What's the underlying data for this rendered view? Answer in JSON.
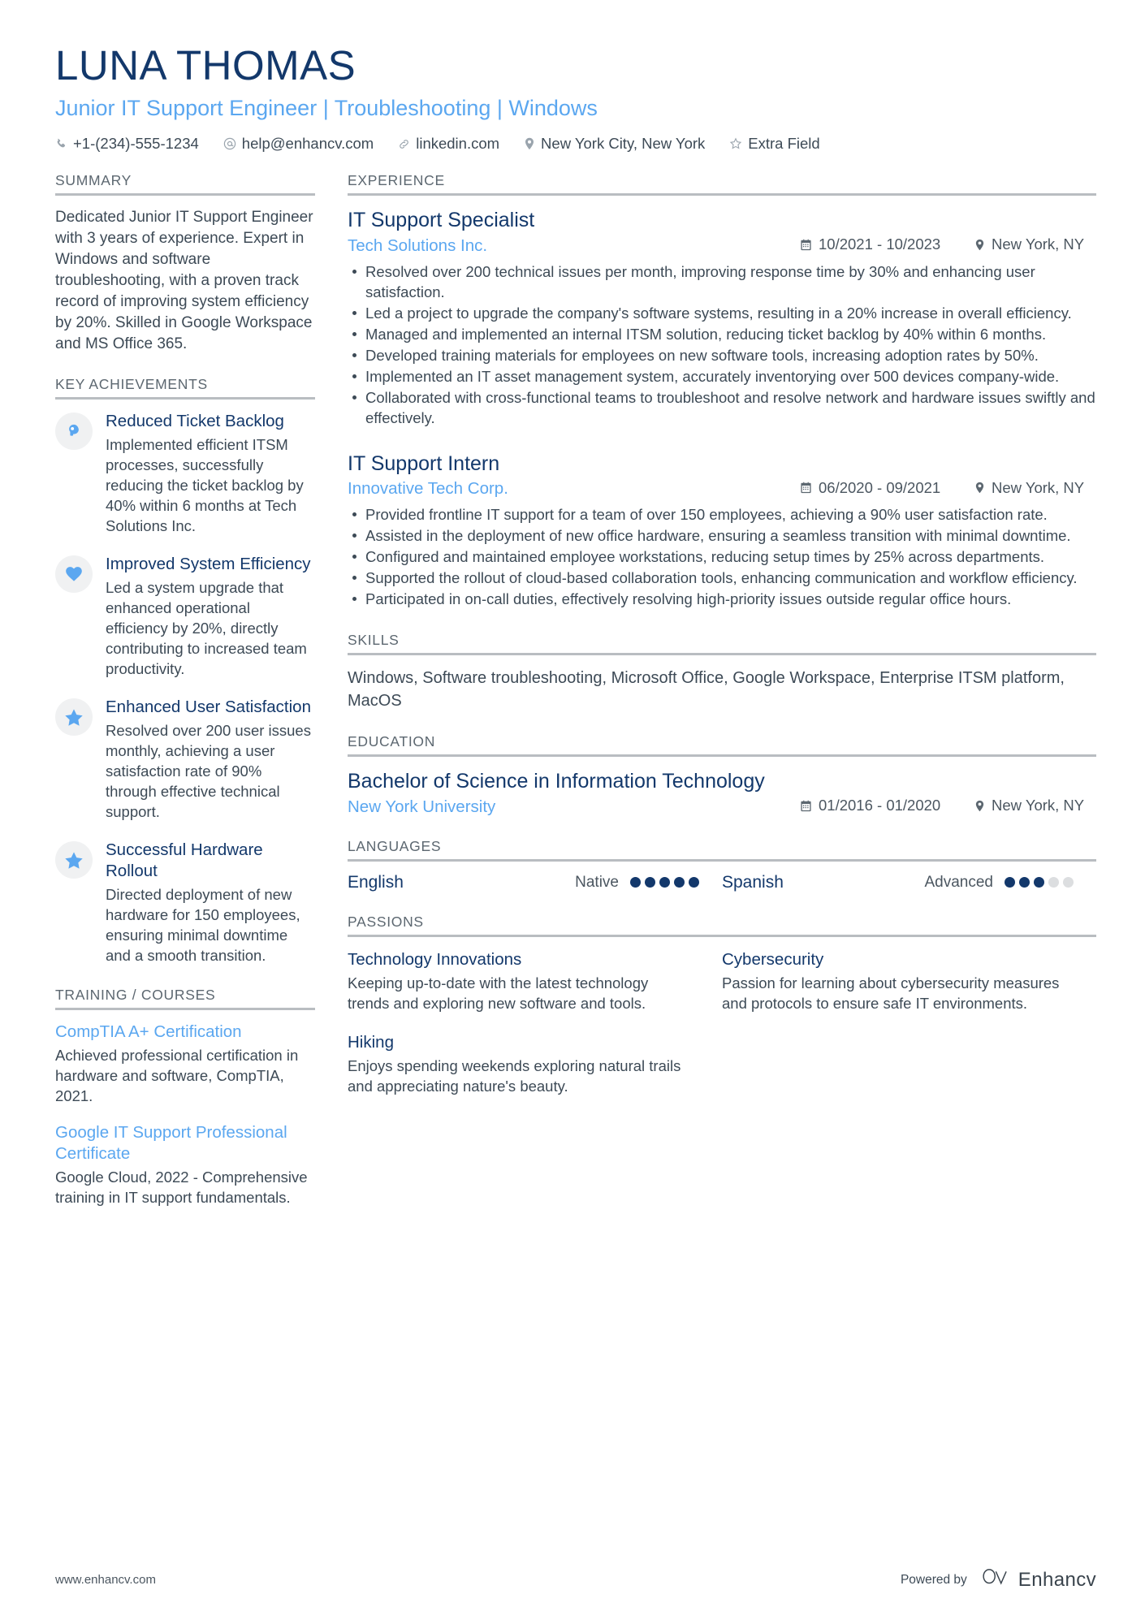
{
  "header": {
    "name": "LUNA THOMAS",
    "headline": "Junior IT Support Engineer | Troubleshooting | Windows",
    "contacts": [
      {
        "icon": "phone-icon",
        "text": "+1-(234)-555-1234"
      },
      {
        "icon": "email-icon",
        "text": "help@enhancv.com"
      },
      {
        "icon": "link-icon",
        "text": "linkedin.com"
      },
      {
        "icon": "location-icon",
        "text": "New York City, New York"
      },
      {
        "icon": "star-outline-icon",
        "text": "Extra Field"
      }
    ]
  },
  "summary": {
    "title": "SUMMARY",
    "text": "Dedicated Junior IT Support Engineer with 3 years of experience. Expert in Windows and software troubleshooting, with a proven track record of improving system efficiency by 20%. Skilled in Google Workspace and MS Office 365."
  },
  "key_achievements": {
    "title": "KEY ACHIEVEMENTS",
    "items": [
      {
        "icon": "head-thought-icon",
        "title": "Reduced Ticket Backlog",
        "desc": "Implemented efficient ITSM processes, successfully reducing the ticket backlog by 40% within 6 months at Tech Solutions Inc."
      },
      {
        "icon": "heart-icon",
        "title": "Improved System Efficiency",
        "desc": "Led a system upgrade that enhanced operational efficiency by 20%, directly contributing to increased team productivity."
      },
      {
        "icon": "star-icon",
        "title": "Enhanced User Satisfaction",
        "desc": "Resolved over 200 user issues monthly, achieving a user satisfaction rate of 90% through effective technical support."
      },
      {
        "icon": "star-icon",
        "title": "Successful Hardware Rollout",
        "desc": "Directed deployment of new hardware for 150 employees, ensuring minimal downtime and a smooth transition."
      }
    ]
  },
  "training": {
    "title": "TRAINING / COURSES",
    "items": [
      {
        "title": "CompTIA A+ Certification",
        "desc": "Achieved professional certification in hardware and software, CompTIA, 2021."
      },
      {
        "title": "Google IT Support Professional Certificate",
        "desc": "Google Cloud, 2022 - Comprehensive training in IT support fundamentals."
      }
    ]
  },
  "experience": {
    "title": "EXPERIENCE",
    "items": [
      {
        "role": "IT Support Specialist",
        "company": "Tech Solutions Inc.",
        "dates": "10/2021 - 10/2023",
        "location": "New York, NY",
        "bullets": [
          "Resolved over 200 technical issues per month, improving response time by 30% and enhancing user satisfaction.",
          "Led a project to upgrade the company's software systems, resulting in a 20% increase in overall efficiency.",
          "Managed and implemented an internal ITSM solution, reducing ticket backlog by 40% within 6 months.",
          "Developed training materials for employees on new software tools, increasing adoption rates by 50%.",
          "Implemented an IT asset management system, accurately inventorying over 500 devices company-wide.",
          "Collaborated with cross-functional teams to troubleshoot and resolve network and hardware issues swiftly and effectively."
        ]
      },
      {
        "role": "IT Support Intern",
        "company": "Innovative Tech Corp.",
        "dates": "06/2020 - 09/2021",
        "location": "New York, NY",
        "bullets": [
          "Provided frontline IT support for a team of over 150 employees, achieving a 90% user satisfaction rate.",
          "Assisted in the deployment of new office hardware, ensuring a seamless transition with minimal downtime.",
          "Configured and maintained employee workstations, reducing setup times by 25% across departments.",
          "Supported the rollout of cloud-based collaboration tools, enhancing communication and workflow efficiency.",
          "Participated in on-call duties, effectively resolving high-priority issues outside regular office hours."
        ]
      }
    ]
  },
  "skills": {
    "title": "SKILLS",
    "text": "Windows, Software troubleshooting, Microsoft Office, Google Workspace, Enterprise ITSM platform, MacOS"
  },
  "education": {
    "title": "EDUCATION",
    "items": [
      {
        "degree": "Bachelor of Science in Information Technology",
        "school": "New York University",
        "dates": "01/2016 - 01/2020",
        "location": "New York, NY"
      }
    ]
  },
  "languages": {
    "title": "LANGUAGES",
    "items": [
      {
        "name": "English",
        "level": "Native",
        "filled": 5,
        "total": 5
      },
      {
        "name": "Spanish",
        "level": "Advanced",
        "filled": 3,
        "total": 5
      }
    ]
  },
  "passions": {
    "title": "PASSIONS",
    "items": [
      {
        "title": "Technology Innovations",
        "desc": "Keeping up-to-date with the latest technology trends and exploring new software and tools."
      },
      {
        "title": "Cybersecurity",
        "desc": "Passion for learning about cybersecurity measures and protocols to ensure safe IT environments."
      },
      {
        "title": "Hiking",
        "desc": "Enjoys spending weekends exploring natural trails and appreciating nature's beauty."
      }
    ]
  },
  "footer": {
    "url": "www.enhancv.com",
    "powered_by": "Powered by",
    "brand": "Enhancv"
  },
  "colors": {
    "navy": "#13386b",
    "accent_blue": "#5ba7f0",
    "body_text": "#3d4a56",
    "rule": "#b9bdc1"
  }
}
